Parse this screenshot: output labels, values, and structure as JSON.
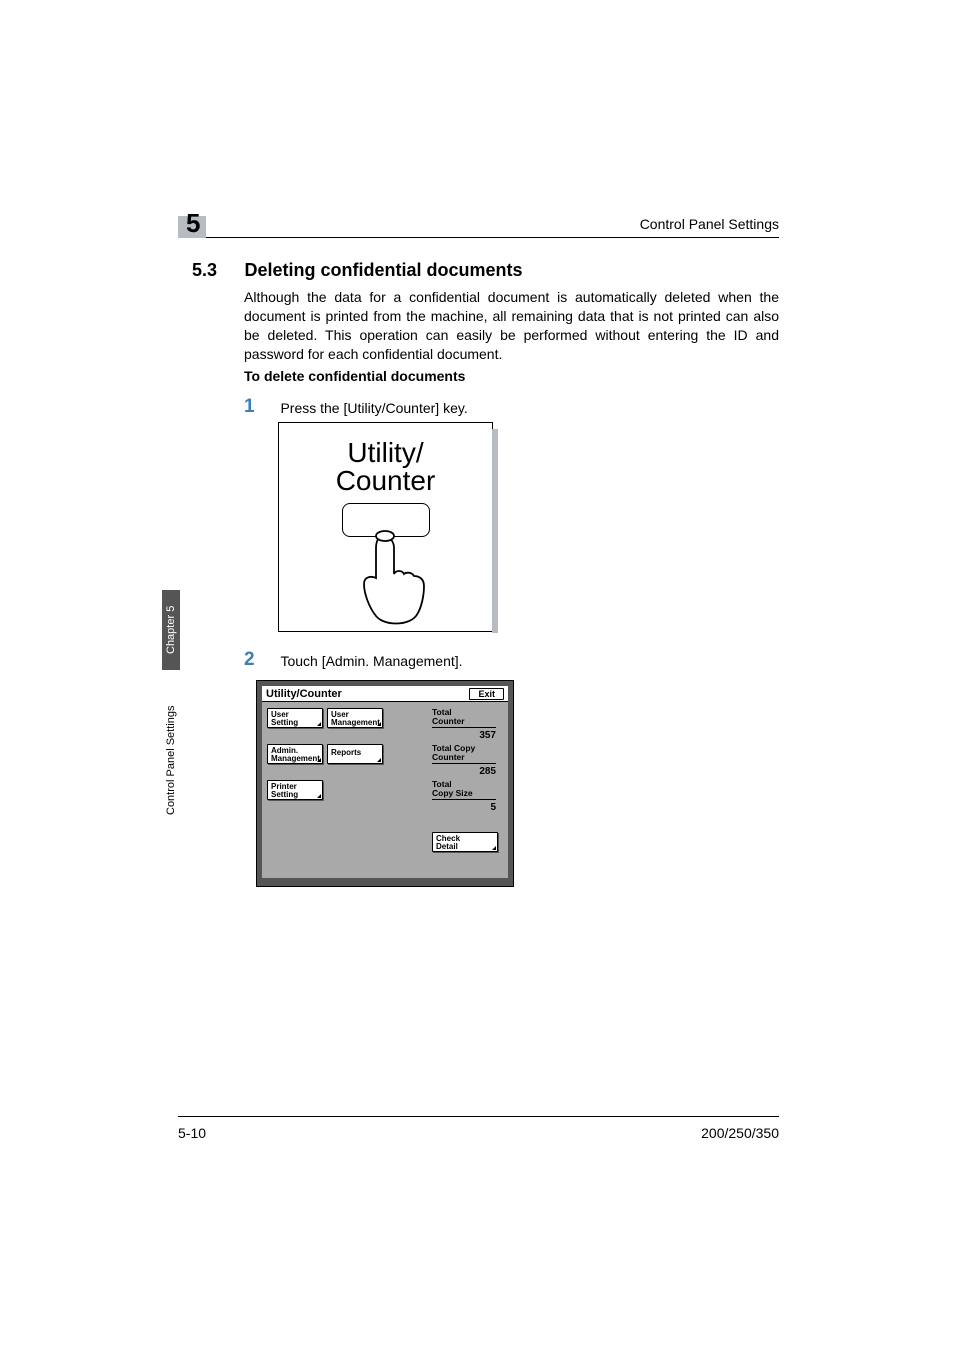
{
  "header": {
    "chapter_number": "5",
    "running_title": "Control Panel Settings"
  },
  "section": {
    "number": "5.3",
    "title": "Deleting confidential documents",
    "body": "Although the data for a confidential document is automatically deleted when the document is printed from the machine, all remaining data that is not printed can also be deleted. This operation can easily be performed without entering the ID and password for each confidential document.",
    "sub_heading": "To delete confidential documents"
  },
  "steps": {
    "one": {
      "num": "1",
      "text": "Press the [Utility/Counter] key."
    },
    "two": {
      "num": "2",
      "text": "Touch [Admin. Management]."
    }
  },
  "illus1": {
    "label_top": "Utility/",
    "label_bottom": "Counter"
  },
  "panel": {
    "title": "Utility/Counter",
    "exit": "Exit",
    "buttons": {
      "user_setting": "User\nSetting",
      "user_management": "User\nManagement",
      "admin_management": "Admin.\nManagement",
      "reports": "Reports",
      "printer_setting": "Printer\nSetting",
      "check_detail": "Check\nDetail"
    },
    "counters": {
      "total_counter_label": "Total\nCounter",
      "total_counter_value": "357",
      "total_copy_counter_label": "Total Copy\nCounter",
      "total_copy_counter_value": "285",
      "total_copy_size_label": "Total\nCopy Size",
      "total_copy_size_value": "5"
    }
  },
  "sidetab": {
    "dark": "Chapter 5",
    "light": "Control Panel Settings"
  },
  "footer": {
    "left": "5-10",
    "right": "200/250/350"
  }
}
